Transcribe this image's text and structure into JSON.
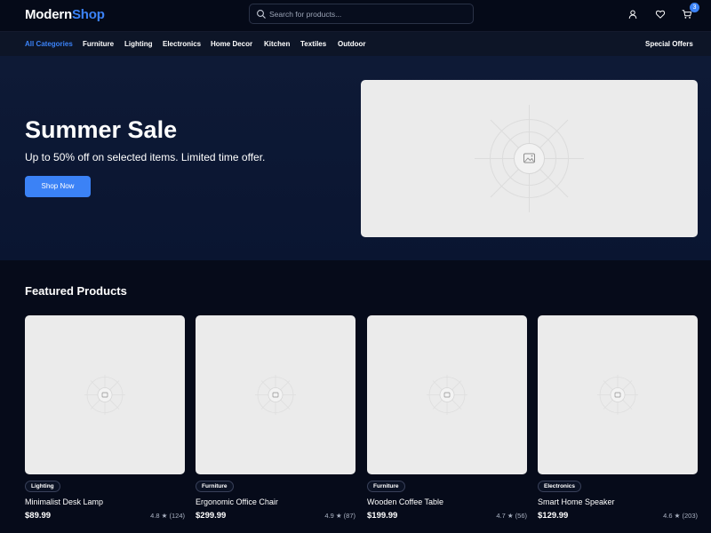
{
  "header": {
    "logo_part1": "Modern",
    "logo_part2": "Shop",
    "search_placeholder": "Search for products...",
    "cart_count": "3",
    "icons": [
      "search-icon",
      "user-icon",
      "heart-icon",
      "cart-icon"
    ]
  },
  "nav": {
    "items": [
      "All Categories",
      "Furniture",
      "Lighting",
      "Electronics",
      "Home Decor",
      "Kitchen",
      "Textiles",
      "Outdoor"
    ],
    "special": "Special Offers"
  },
  "hero": {
    "title": "Summer Sale",
    "subtitle": "Up to 50% off on selected items. Limited time offer.",
    "button": "Shop Now"
  },
  "featured": {
    "title": "Featured Products",
    "products": [
      {
        "category": "Lighting",
        "name": "Minimalist Desk Lamp",
        "price": "$89.99",
        "rating": "4.8 ★ (124)"
      },
      {
        "category": "Furniture",
        "name": "Ergonomic Office Chair",
        "price": "$299.99",
        "rating": "4.9 ★ (87)"
      },
      {
        "category": "Furniture",
        "name": "Wooden Coffee Table",
        "price": "$199.99",
        "rating": "4.7 ★ (56)"
      },
      {
        "category": "Electronics",
        "name": "Smart Home Speaker",
        "price": "$129.99",
        "rating": "4.6 ★ (203)"
      }
    ]
  },
  "colors": {
    "accent": "#3b82f6",
    "background": "#060b1a",
    "nav_background": "#0d1527",
    "hero_background": "#0e1a36",
    "placeholder": "#ebebeb"
  }
}
